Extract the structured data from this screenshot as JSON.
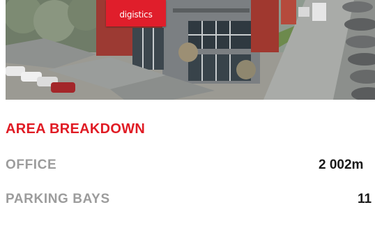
{
  "hero": {
    "sign_text": "digistics"
  },
  "area_breakdown": {
    "title": "AREA BREAKDOWN",
    "rows": [
      {
        "label": "OFFICE",
        "value": "2 002m"
      },
      {
        "label": "PARKING BAYS",
        "value": "11"
      }
    ]
  },
  "colors": {
    "accent": "#e01b24",
    "label_gray": "#9c9c9c",
    "value_dark": "#1a1a1a"
  }
}
